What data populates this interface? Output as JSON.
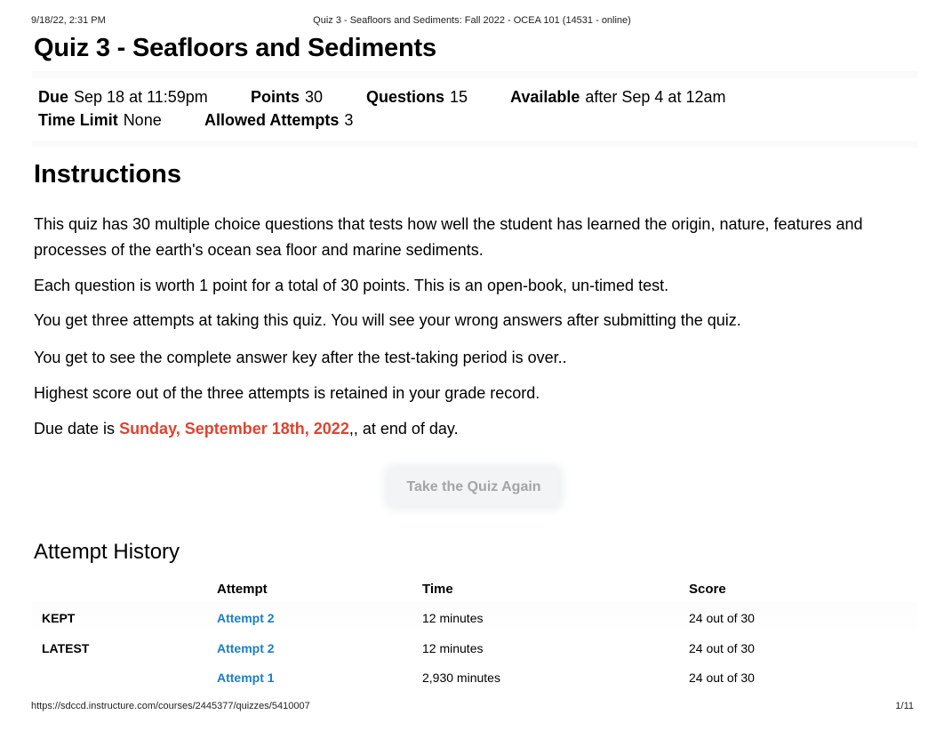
{
  "print_header": {
    "datetime": "9/18/22, 2:31 PM",
    "page_title": "Quiz 3 - Seafloors and Sediments: Fall 2022 - OCEA 101 (14531 - online)"
  },
  "quiz": {
    "title": "Quiz 3 - Seafloors and Sediments",
    "details": [
      {
        "label": "Due",
        "value": "Sep 18 at 11:59pm"
      },
      {
        "label": "Points",
        "value": "30"
      },
      {
        "label": "Questions",
        "value": "15"
      },
      {
        "label": "Available",
        "value": "after Sep 4 at 12am"
      },
      {
        "label": "Time Limit",
        "value": "None"
      },
      {
        "label": "Allowed Attempts",
        "value": "3"
      }
    ]
  },
  "instructions": {
    "heading": "Instructions",
    "paragraphs": [
      "This quiz has 30 multiple choice questions that tests how well the student has learned the origin, nature, features and processes of the earth's ocean sea floor and marine sediments.",
      "Each question is worth 1 point for a total of 30 points. This is an open-book, un-timed test.",
      "You get three attempts at taking this quiz. You will see your wrong answers after submitting the quiz.",
      "You get to see the complete answer key after the test-taking period is over..",
      "Highest score out of the three attempts is retained in your grade record."
    ],
    "due_prefix": "Due date is ",
    "due_highlight": "Sunday, September 18th, 2022",
    "due_suffix": ",, at end of day.",
    "highlight_color": "#e0432f"
  },
  "take_quiz_button": "Take the Quiz Again",
  "attempt_history": {
    "heading": "Attempt History",
    "columns": [
      "",
      "Attempt",
      "Time",
      "Score"
    ],
    "rows": [
      {
        "tag": "KEPT",
        "attempt": "Attempt 2",
        "time": "12 minutes",
        "score": "24 out of 30"
      },
      {
        "tag": "LATEST",
        "attempt": "Attempt 2",
        "time": "12 minutes",
        "score": "24 out of 30"
      },
      {
        "tag": "",
        "attempt": "Attempt 1",
        "time": "2,930 minutes",
        "score": "24 out of 30"
      }
    ],
    "link_color": "#1a7fc2"
  },
  "print_footer": {
    "url": "https://sdccd.instructure.com/courses/2445377/quizzes/5410007",
    "page": "1/11"
  }
}
